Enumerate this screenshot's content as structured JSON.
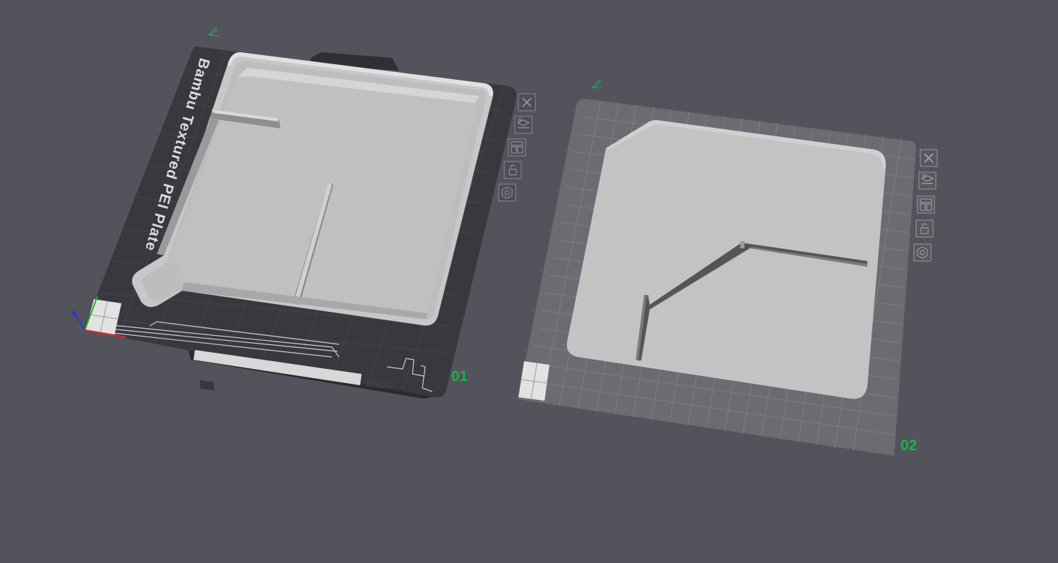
{
  "viewport": {
    "background": "#53535b",
    "accent": "#1bb24a"
  },
  "plates": [
    {
      "number": "01",
      "brand": "Bambu Textured PEI Plate",
      "surface": "textured-pei",
      "name_icon": "pencil-icon",
      "buttons": [
        {
          "name": "delete-plate-button",
          "icon": "close-icon"
        },
        {
          "name": "auto-orient-button",
          "icon": "orient-icon"
        },
        {
          "name": "arrange-button",
          "icon": "arrange-icon"
        },
        {
          "name": "lock-plate-button",
          "icon": "lock-icon"
        },
        {
          "name": "plate-settings-button",
          "icon": "settings-icon"
        }
      ]
    },
    {
      "number": "02",
      "brand": "",
      "surface": "grid",
      "name_icon": "pencil-icon",
      "buttons": [
        {
          "name": "delete-plate-button",
          "icon": "close-icon"
        },
        {
          "name": "auto-orient-button",
          "icon": "orient-icon"
        },
        {
          "name": "arrange-button",
          "icon": "arrange-icon"
        },
        {
          "name": "lock-plate-button",
          "icon": "lock-icon"
        },
        {
          "name": "plate-settings-button",
          "icon": "settings-icon"
        }
      ]
    }
  ],
  "axes": {
    "x_color": "#d22a2a",
    "y_color": "#2ab02a",
    "z_color": "#2a3ad2"
  }
}
